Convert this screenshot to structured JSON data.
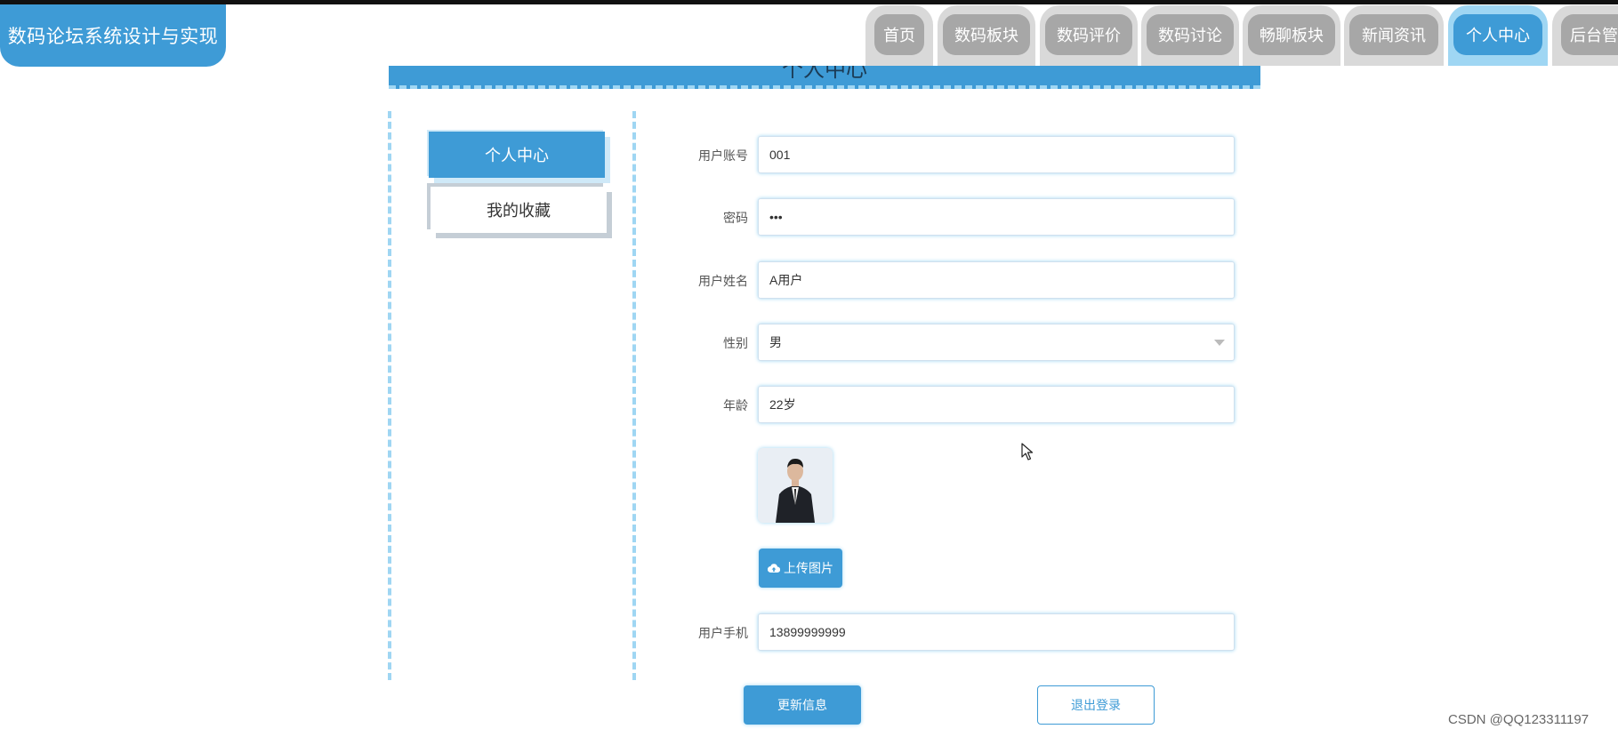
{
  "app": {
    "title": "数码论坛系统设计与实现"
  },
  "nav": {
    "items": [
      {
        "label": "首页"
      },
      {
        "label": "数码板块"
      },
      {
        "label": "数码评价"
      },
      {
        "label": "数码讨论"
      },
      {
        "label": "畅聊板块"
      },
      {
        "label": "新闻资讯"
      },
      {
        "label": "个人中心",
        "active": true
      },
      {
        "label": "后台管"
      }
    ]
  },
  "page": {
    "title": "个人中心"
  },
  "sidebar": {
    "items": [
      {
        "label": "个人中心",
        "active": true
      },
      {
        "label": "我的收藏"
      }
    ]
  },
  "form": {
    "account": {
      "label": "用户账号",
      "value": "001"
    },
    "password": {
      "label": "密码",
      "value": "•••"
    },
    "name": {
      "label": "用户姓名",
      "value": "A用户"
    },
    "gender": {
      "label": "性别",
      "value": "男"
    },
    "age": {
      "label": "年龄",
      "value": "22岁"
    },
    "avatar": {
      "upload_label": "上传图片"
    },
    "phone": {
      "label": "用户手机",
      "value": "13899999999"
    }
  },
  "actions": {
    "update_label": "更新信息",
    "logout_label": "退出登录"
  },
  "watermark": "CSDN @QQ123311197",
  "colors": {
    "primary": "#3e9bd6",
    "accent_light": "#9fd6f3",
    "tab_inactive": "#a7a7a7"
  },
  "icons": {
    "upload": "cloud-upload-icon",
    "select": "chevron-down-icon",
    "cursor": "mouse-pointer-icon"
  }
}
